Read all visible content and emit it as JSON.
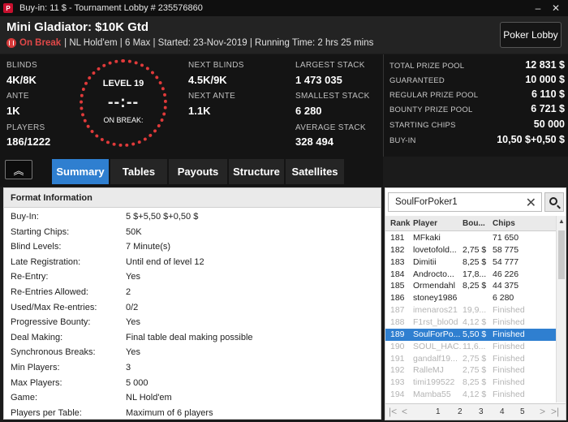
{
  "window": {
    "title": "Buy-in: 11 $ - Tournament Lobby # 235576860",
    "logo_glyph": "P",
    "minimize": "–",
    "close": "✕"
  },
  "header": {
    "name": "Mini Gladiator: $10K Gtd",
    "status": "On Break",
    "details": "| NL Hold'em | 6 Max | Started: 23-Nov-2019 | Running Time: 2 hrs  25 mins",
    "lobby_button": "Poker Lobby"
  },
  "stats": {
    "blinds_label": "BLINDS",
    "blinds": "4K/8K",
    "ante_label": "ANTE",
    "ante": "1K",
    "players_label": "PLAYERS",
    "players": "186/1222",
    "level": "LEVEL 19",
    "clock": "--:--",
    "clock_status": "ON BREAK:",
    "next_blinds_label": "NEXT BLINDS",
    "next_blinds": "4.5K/9K",
    "next_ante_label": "NEXT ANTE",
    "next_ante": "1.1K",
    "largest_label": "LARGEST STACK",
    "largest": "1 473 035",
    "smallest_label": "SMALLEST STACK",
    "smallest": "6 280",
    "average_label": "AVERAGE STACK",
    "average": "328 494"
  },
  "prize": [
    {
      "label": "TOTAL PRIZE POOL",
      "value": "12 831 $"
    },
    {
      "label": "GUARANTEED",
      "value": "10 000 $"
    },
    {
      "label": "REGULAR PRIZE POOL",
      "value": "6 110 $"
    },
    {
      "label": "BOUNTY PRIZE POOL",
      "value": "6 721 $"
    },
    {
      "label": "STARTING CHIPS",
      "value": "50 000"
    },
    {
      "label": "BUY-IN",
      "value": "10,50 $+0,50 $"
    }
  ],
  "tabs": {
    "collapse_glyph": "︽",
    "items": [
      "Summary",
      "Tables",
      "Payouts",
      "Structure",
      "Satellites"
    ],
    "active": "Summary"
  },
  "format": {
    "title": "Format Information",
    "rows": [
      {
        "label": "Buy-In:",
        "value": "5 $+5,50 $+0,50 $"
      },
      {
        "label": "Starting Chips:",
        "value": "50K"
      },
      {
        "label": "Blind Levels:",
        "value": "7 Minute(s)"
      },
      {
        "label": "Late Registration:",
        "value": "Until end of level 12"
      },
      {
        "label": "Re-Entry:",
        "value": "Yes"
      },
      {
        "label": "Re-Entries Allowed:",
        "value": "2"
      },
      {
        "label": "Used/Max Re-entries:",
        "value": "0/2"
      },
      {
        "label": "Progressive Bounty:",
        "value": "Yes"
      },
      {
        "label": "Deal Making:",
        "value": "Final table deal making possible"
      },
      {
        "label": "Synchronous Breaks:",
        "value": "Yes"
      },
      {
        "label": "Min Players:",
        "value": "3"
      },
      {
        "label": "Max Players:",
        "value": "5 000"
      },
      {
        "label": "Game:",
        "value": "NL Hold'em"
      },
      {
        "label": "Players per Table:",
        "value": "Maximum of 6 players"
      }
    ]
  },
  "players": {
    "search_value": "SoulForPoker1",
    "clear_glyph": "✕",
    "columns": [
      "Rank",
      "Player",
      "Bou...",
      "Chips"
    ],
    "rows": [
      {
        "rank": "181",
        "player": "MFkaki",
        "bounty": "",
        "chips": "71 650",
        "status": "active"
      },
      {
        "rank": "182",
        "player": "lovetofold...",
        "bounty": "2,75 $",
        "chips": "58 775",
        "status": "active"
      },
      {
        "rank": "183",
        "player": "Dimitii",
        "bounty": "8,25 $",
        "chips": "54 777",
        "status": "active"
      },
      {
        "rank": "184",
        "player": "Androcto...",
        "bounty": "17,8...",
        "chips": "46 226",
        "status": "active"
      },
      {
        "rank": "185",
        "player": "Ormendahl",
        "bounty": "8,25 $",
        "chips": "44 375",
        "status": "active"
      },
      {
        "rank": "186",
        "player": "stoney1986",
        "bounty": "",
        "chips": "6 280",
        "status": "active"
      },
      {
        "rank": "187",
        "player": "imenaros21",
        "bounty": "19,9...",
        "chips": "Finished",
        "status": "finished"
      },
      {
        "rank": "188",
        "player": "F1rst_blo0d",
        "bounty": "4,12 $",
        "chips": "Finished",
        "status": "finished"
      },
      {
        "rank": "189",
        "player": "SoulForPo...",
        "bounty": "5,50 $",
        "chips": "Finished",
        "status": "selected"
      },
      {
        "rank": "190",
        "player": "SOUL_HAC...",
        "bounty": "11,6...",
        "chips": "Finished",
        "status": "finished"
      },
      {
        "rank": "191",
        "player": "gandalf19...",
        "bounty": "2,75 $",
        "chips": "Finished",
        "status": "finished"
      },
      {
        "rank": "192",
        "player": "RalleMJ",
        "bounty": "2,75 $",
        "chips": "Finished",
        "status": "finished"
      },
      {
        "rank": "193",
        "player": "timi199522",
        "bounty": "8,25 $",
        "chips": "Finished",
        "status": "finished"
      },
      {
        "rank": "194",
        "player": "Mamba55",
        "bounty": "4,12 $",
        "chips": "Finished",
        "status": "finished"
      }
    ],
    "pager": {
      "first": "|<",
      "prev": "<",
      "pages": [
        "1",
        "2",
        "3",
        "4",
        "5"
      ],
      "next": ">",
      "last": ">|"
    }
  }
}
